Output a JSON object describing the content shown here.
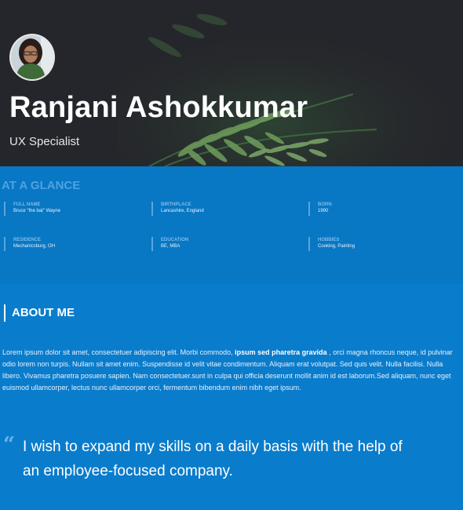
{
  "profile": {
    "name": "Ranjani Ashokkumar",
    "title": "UX Specialist"
  },
  "glance": {
    "heading": "AT A GLANCE",
    "facts": [
      {
        "label": "FULL NAME",
        "value": "Bruce \"the bat\" Wayne"
      },
      {
        "label": "BIRTHPLACE",
        "value": "Lancashire, England"
      },
      {
        "label": "BORN",
        "value": "1990"
      },
      {
        "label": "RESIDENCE",
        "value": "Mechanicsburg, OH"
      },
      {
        "label": "EDUCATION",
        "value": "BE, MBA"
      },
      {
        "label": "HOBBIES",
        "value": "Cooking, Painting"
      }
    ]
  },
  "about": {
    "heading": "ABOUT ME",
    "text_before": "Lorem ipsum dolor sit amet, consectetuer adipiscing elit. Morbi commodo, ",
    "text_bold": "ipsum sed pharetra gravida",
    "text_after": " , orci magna rhoncus neque, id pulvinar odio lorem non turpis. Nullam sit amet enim. Suspendisse id velit vitae condimentum. Aliquam erat volutpat. Sed quis velit. Nulla facilisi. Nulla libero. Vivamus pharetra posuere sapien. Nam consectetuer.sunt in culpa qui officia deserunt mollit anim id est laborum.Sed aliquam, nunc eget euismod ullamcorper, lectus nunc ullamcorper orci, fermentum bibendum enim nibh eget ipsum.",
    "quote_mark": "“",
    "quote": "I wish to expand my skills on a daily basis with the help of an employee-focused company."
  },
  "colors": {
    "hero_bg": "#25262b",
    "glance_bg": "#0877c4",
    "about_bg": "#0a7ccc",
    "accent": "#4da3e2"
  },
  "icons": [
    "avatar-photo",
    "fern-background",
    "quote-icon"
  ]
}
